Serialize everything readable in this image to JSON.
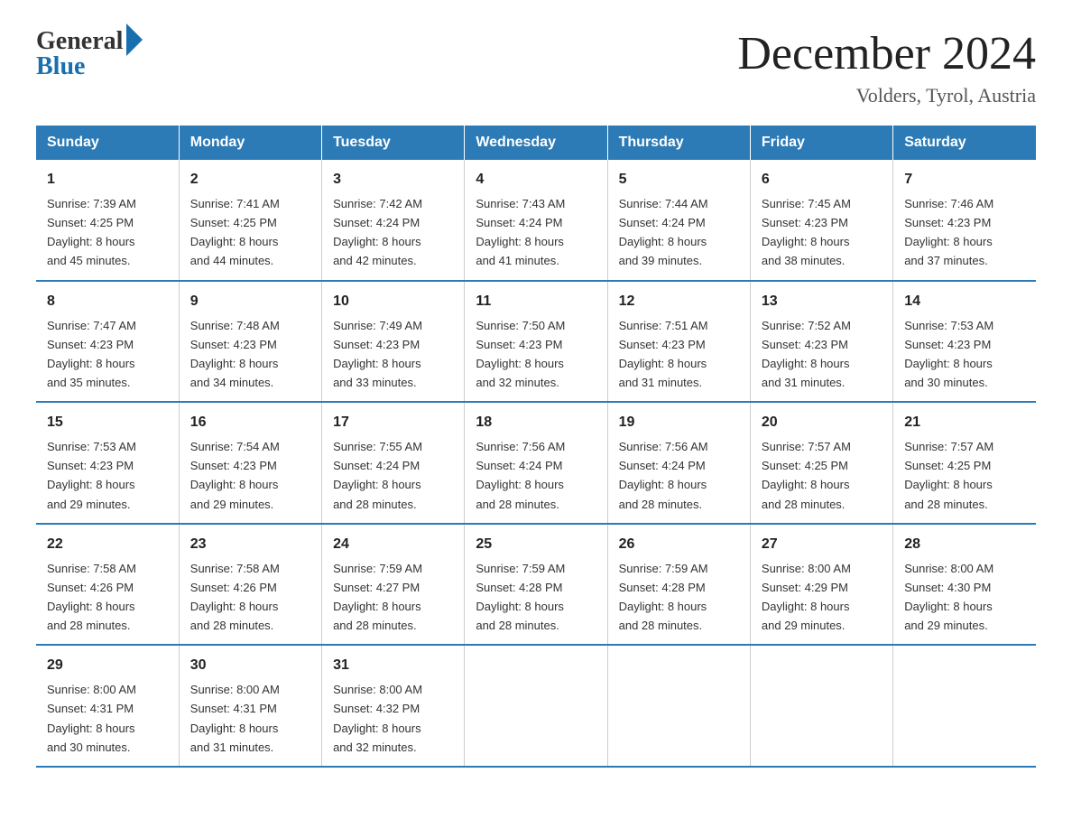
{
  "logo": {
    "general": "General",
    "blue": "Blue"
  },
  "title": "December 2024",
  "location": "Volders, Tyrol, Austria",
  "headers": [
    "Sunday",
    "Monday",
    "Tuesday",
    "Wednesday",
    "Thursday",
    "Friday",
    "Saturday"
  ],
  "weeks": [
    [
      {
        "day": "1",
        "sunrise": "7:39 AM",
        "sunset": "4:25 PM",
        "daylight": "8 hours and 45 minutes."
      },
      {
        "day": "2",
        "sunrise": "7:41 AM",
        "sunset": "4:25 PM",
        "daylight": "8 hours and 44 minutes."
      },
      {
        "day": "3",
        "sunrise": "7:42 AM",
        "sunset": "4:24 PM",
        "daylight": "8 hours and 42 minutes."
      },
      {
        "day": "4",
        "sunrise": "7:43 AM",
        "sunset": "4:24 PM",
        "daylight": "8 hours and 41 minutes."
      },
      {
        "day": "5",
        "sunrise": "7:44 AM",
        "sunset": "4:24 PM",
        "daylight": "8 hours and 39 minutes."
      },
      {
        "day": "6",
        "sunrise": "7:45 AM",
        "sunset": "4:23 PM",
        "daylight": "8 hours and 38 minutes."
      },
      {
        "day": "7",
        "sunrise": "7:46 AM",
        "sunset": "4:23 PM",
        "daylight": "8 hours and 37 minutes."
      }
    ],
    [
      {
        "day": "8",
        "sunrise": "7:47 AM",
        "sunset": "4:23 PM",
        "daylight": "8 hours and 35 minutes."
      },
      {
        "day": "9",
        "sunrise": "7:48 AM",
        "sunset": "4:23 PM",
        "daylight": "8 hours and 34 minutes."
      },
      {
        "day": "10",
        "sunrise": "7:49 AM",
        "sunset": "4:23 PM",
        "daylight": "8 hours and 33 minutes."
      },
      {
        "day": "11",
        "sunrise": "7:50 AM",
        "sunset": "4:23 PM",
        "daylight": "8 hours and 32 minutes."
      },
      {
        "day": "12",
        "sunrise": "7:51 AM",
        "sunset": "4:23 PM",
        "daylight": "8 hours and 31 minutes."
      },
      {
        "day": "13",
        "sunrise": "7:52 AM",
        "sunset": "4:23 PM",
        "daylight": "8 hours and 31 minutes."
      },
      {
        "day": "14",
        "sunrise": "7:53 AM",
        "sunset": "4:23 PM",
        "daylight": "8 hours and 30 minutes."
      }
    ],
    [
      {
        "day": "15",
        "sunrise": "7:53 AM",
        "sunset": "4:23 PM",
        "daylight": "8 hours and 29 minutes."
      },
      {
        "day": "16",
        "sunrise": "7:54 AM",
        "sunset": "4:23 PM",
        "daylight": "8 hours and 29 minutes."
      },
      {
        "day": "17",
        "sunrise": "7:55 AM",
        "sunset": "4:24 PM",
        "daylight": "8 hours and 28 minutes."
      },
      {
        "day": "18",
        "sunrise": "7:56 AM",
        "sunset": "4:24 PM",
        "daylight": "8 hours and 28 minutes."
      },
      {
        "day": "19",
        "sunrise": "7:56 AM",
        "sunset": "4:24 PM",
        "daylight": "8 hours and 28 minutes."
      },
      {
        "day": "20",
        "sunrise": "7:57 AM",
        "sunset": "4:25 PM",
        "daylight": "8 hours and 28 minutes."
      },
      {
        "day": "21",
        "sunrise": "7:57 AM",
        "sunset": "4:25 PM",
        "daylight": "8 hours and 28 minutes."
      }
    ],
    [
      {
        "day": "22",
        "sunrise": "7:58 AM",
        "sunset": "4:26 PM",
        "daylight": "8 hours and 28 minutes."
      },
      {
        "day": "23",
        "sunrise": "7:58 AM",
        "sunset": "4:26 PM",
        "daylight": "8 hours and 28 minutes."
      },
      {
        "day": "24",
        "sunrise": "7:59 AM",
        "sunset": "4:27 PM",
        "daylight": "8 hours and 28 minutes."
      },
      {
        "day": "25",
        "sunrise": "7:59 AM",
        "sunset": "4:28 PM",
        "daylight": "8 hours and 28 minutes."
      },
      {
        "day": "26",
        "sunrise": "7:59 AM",
        "sunset": "4:28 PM",
        "daylight": "8 hours and 28 minutes."
      },
      {
        "day": "27",
        "sunrise": "8:00 AM",
        "sunset": "4:29 PM",
        "daylight": "8 hours and 29 minutes."
      },
      {
        "day": "28",
        "sunrise": "8:00 AM",
        "sunset": "4:30 PM",
        "daylight": "8 hours and 29 minutes."
      }
    ],
    [
      {
        "day": "29",
        "sunrise": "8:00 AM",
        "sunset": "4:31 PM",
        "daylight": "8 hours and 30 minutes."
      },
      {
        "day": "30",
        "sunrise": "8:00 AM",
        "sunset": "4:31 PM",
        "daylight": "8 hours and 31 minutes."
      },
      {
        "day": "31",
        "sunrise": "8:00 AM",
        "sunset": "4:32 PM",
        "daylight": "8 hours and 32 minutes."
      },
      null,
      null,
      null,
      null
    ]
  ],
  "labels": {
    "sunrise": "Sunrise:",
    "sunset": "Sunset:",
    "daylight": "Daylight:"
  }
}
